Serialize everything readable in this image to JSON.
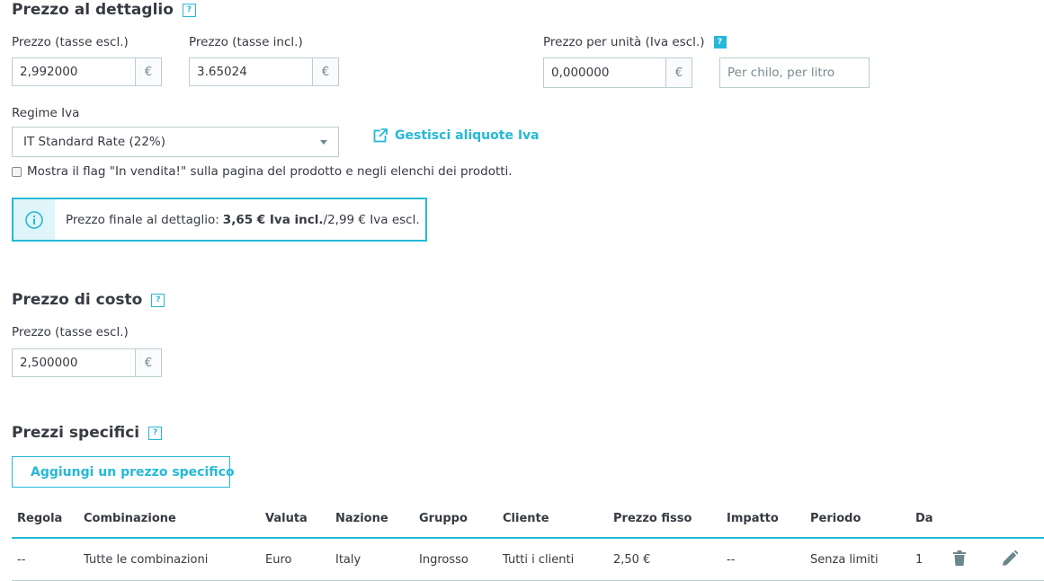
{
  "retail": {
    "title": "Prezzo al dettaglio",
    "help": "?",
    "price_excl": {
      "label": "Prezzo (tasse escl.)",
      "value": "2,992000",
      "currency": "€"
    },
    "price_incl": {
      "label": "Prezzo (tasse incl.)",
      "value": "3.65024",
      "currency": "€"
    },
    "unit_price": {
      "label": "Prezzo per unità (Iva escl.)",
      "value": "0,000000",
      "currency": "€",
      "unit_placeholder": "Per chilo, per litro",
      "help": "?"
    },
    "tax_rule": {
      "label": "Regime Iva",
      "value": "IT Standard Rate (22%)"
    },
    "manage_tax_link": "Gestisci aliquote Iva",
    "on_sale_label": "Mostra il flag \"In vendita!\" sulla pagina del prodotto e negli elenchi dei prodotti.",
    "final_price": {
      "prefix": "Prezzo finale al dettaglio: ",
      "bold": "3,65 € Iva incl.",
      "suffix": "/2,99 € Iva escl."
    }
  },
  "cost": {
    "title": "Prezzo di costo",
    "help": "?",
    "price_excl": {
      "label": "Prezzo (tasse escl.)",
      "value": "2,500000",
      "currency": "€"
    }
  },
  "specific": {
    "title": "Prezzi specifici",
    "help": "?",
    "add_button": "Aggiungi un prezzo specifico",
    "columns": [
      "Regola",
      "Combinazione",
      "Valuta",
      "Nazione",
      "Gruppo",
      "Cliente",
      "Prezzo fisso",
      "Impatto",
      "Periodo",
      "Da"
    ],
    "rows": [
      [
        "--",
        "Tutte le combinazioni",
        "Euro",
        "Italy",
        "Ingrosso",
        "Tutti i clienti",
        "2,50 €",
        "--",
        "Senza limiti",
        "1"
      ]
    ]
  },
  "colors": {
    "accent": "#25b9d7",
    "text": "#363a41",
    "border": "#bbcdd2"
  },
  "icons": [
    "help-icon",
    "external-link-icon",
    "info-icon",
    "plus-circle-icon",
    "trash-icon",
    "pencil-icon",
    "chevron-down-icon"
  ]
}
